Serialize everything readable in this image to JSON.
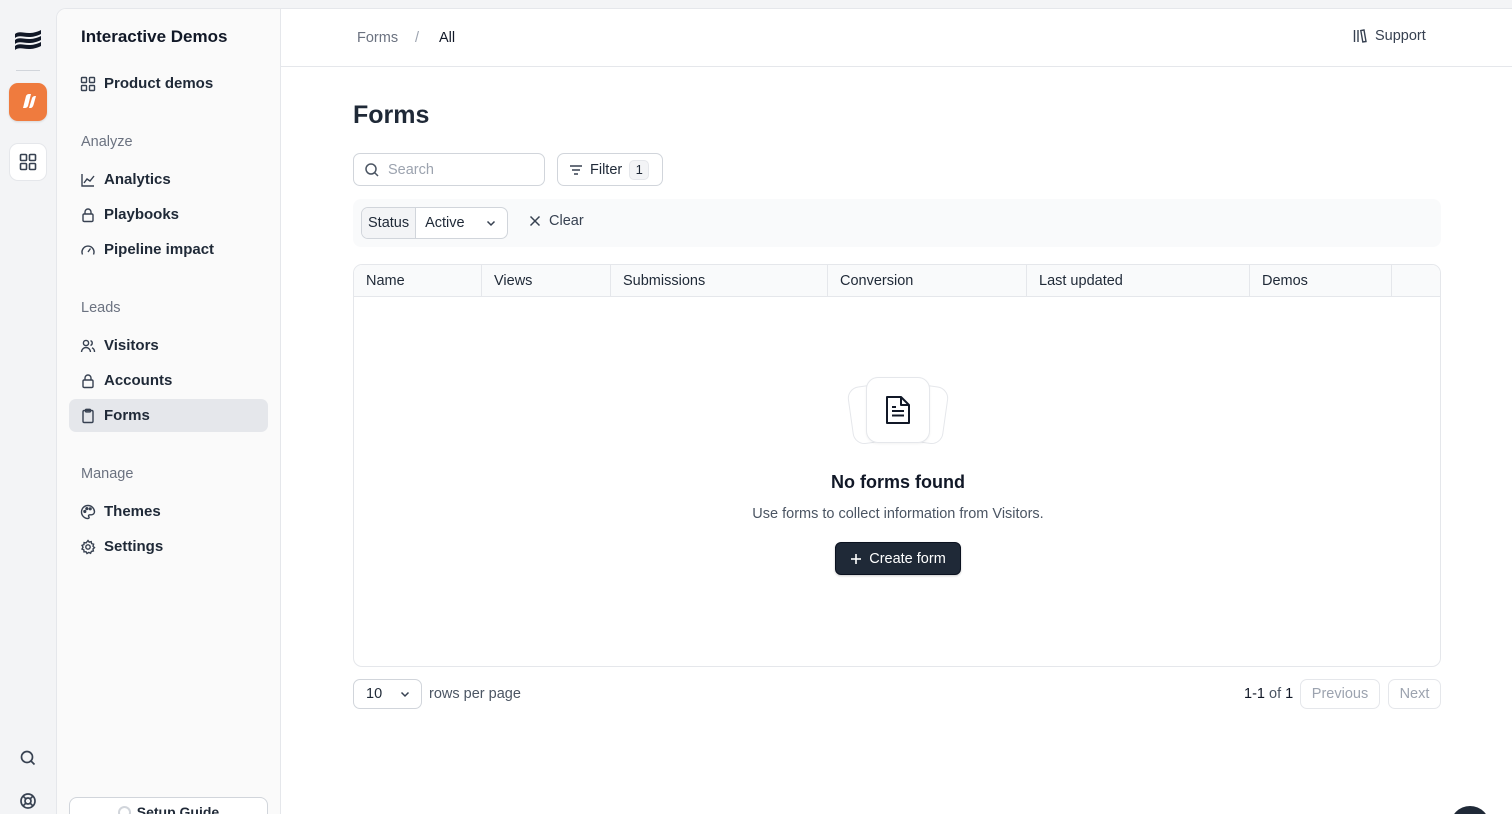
{
  "workspace": {
    "title": "Interactive Demos"
  },
  "sidebar": {
    "top_item": {
      "label": "Product demos"
    },
    "sections": [
      {
        "label": "Analyze",
        "items": [
          {
            "label": "Analytics"
          },
          {
            "label": "Playbooks"
          },
          {
            "label": "Pipeline impact"
          }
        ]
      },
      {
        "label": "Leads",
        "items": [
          {
            "label": "Visitors"
          },
          {
            "label": "Accounts"
          },
          {
            "label": "Forms",
            "active": true
          }
        ]
      },
      {
        "label": "Manage",
        "items": [
          {
            "label": "Themes"
          },
          {
            "label": "Settings"
          }
        ]
      }
    ],
    "setup_guide": "Setup Guide"
  },
  "breadcrumb": {
    "parent": "Forms",
    "separator": "/",
    "current": "All"
  },
  "support": {
    "label": "Support"
  },
  "page": {
    "title": "Forms"
  },
  "search": {
    "placeholder": "Search",
    "value": ""
  },
  "filter": {
    "label": "Filter",
    "count": "1"
  },
  "active_filter": {
    "key": "Status",
    "value": "Active",
    "clear_label": "Clear"
  },
  "table": {
    "columns": [
      "Name",
      "Views",
      "Submissions",
      "Conversion",
      "Last updated",
      "Demos",
      ""
    ]
  },
  "empty_state": {
    "title": "No forms found",
    "description": "Use forms to collect information from Visitors.",
    "button": "Create form"
  },
  "pagination": {
    "rows_per_page_value": "10",
    "rows_per_page_label": "rows per page",
    "range": "1-1",
    "of_label": "of",
    "total": "1",
    "previous": "Previous",
    "next": "Next"
  },
  "colors": {
    "accent": "#ef7b3e",
    "primary_button": "#1f2937",
    "active_nav": "#e5e7eb"
  }
}
